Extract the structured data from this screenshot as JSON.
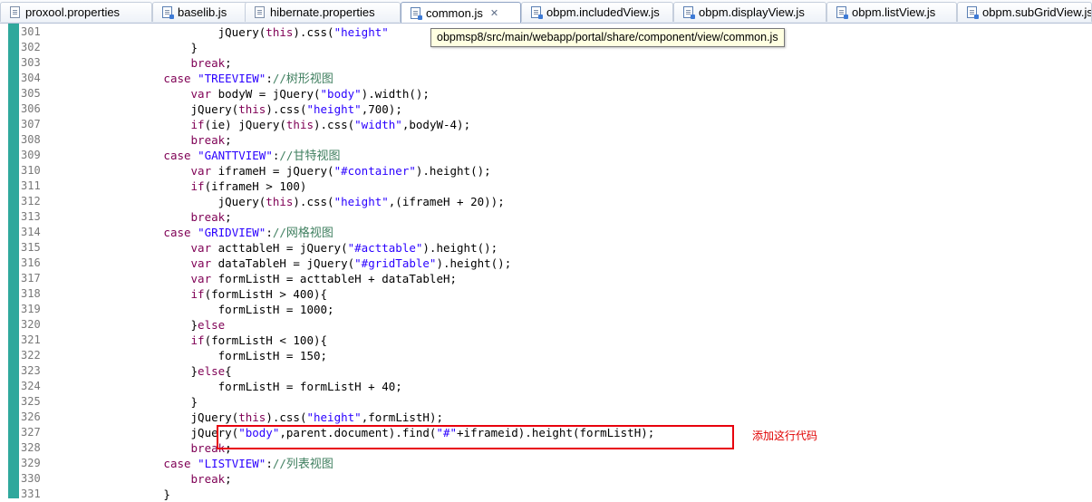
{
  "tabs": [
    {
      "label": "proxool.properties",
      "icon": "properties-file-icon",
      "active": false
    },
    {
      "label": "baselib.js",
      "icon": "js-file-icon",
      "active": false
    },
    {
      "label": "hibernate.properties",
      "icon": "properties-file-icon",
      "active": false
    },
    {
      "label": "common.js",
      "icon": "js-file-icon",
      "active": true,
      "close": "✕"
    },
    {
      "label": "obpm.includedView.js",
      "icon": "js-file-icon",
      "active": false
    },
    {
      "label": "obpm.displayView.js",
      "icon": "js-file-icon",
      "active": false
    },
    {
      "label": "obpm.listView.js",
      "icon": "js-file-icon",
      "active": false
    },
    {
      "label": "obpm.subGridView.js",
      "icon": "js-file-icon",
      "active": false
    }
  ],
  "tooltip": "obpmsp8/src/main/webapp/portal/share/component/view/common.js",
  "annotation": "添加这行代码",
  "lines": [
    {
      "n": "301",
      "segs": [
        [
          "                        jQuery(",
          ""
        ],
        [
          "this",
          "kw"
        ],
        [
          ").css(",
          ""
        ],
        [
          "\"height\"",
          "str"
        ]
      ]
    },
    {
      "n": "302",
      "segs": [
        [
          "                    }",
          ""
        ]
      ]
    },
    {
      "n": "303",
      "segs": [
        [
          "                    ",
          ""
        ],
        [
          "break",
          "kw"
        ],
        [
          ";",
          ""
        ]
      ]
    },
    {
      "n": "304",
      "segs": [
        [
          "                ",
          ""
        ],
        [
          "case",
          "kw"
        ],
        [
          " ",
          ""
        ],
        [
          "\"TREEVIEW\"",
          "str"
        ],
        [
          ":",
          ""
        ],
        [
          "//",
          "cm"
        ],
        [
          "树形视图",
          "cm-zh"
        ]
      ]
    },
    {
      "n": "305",
      "segs": [
        [
          "                    ",
          ""
        ],
        [
          "var",
          "kw"
        ],
        [
          " bodyW = jQuery(",
          ""
        ],
        [
          "\"body\"",
          "str"
        ],
        [
          ").width();",
          ""
        ]
      ]
    },
    {
      "n": "306",
      "segs": [
        [
          "                    jQuery(",
          ""
        ],
        [
          "this",
          "kw"
        ],
        [
          ").css(",
          ""
        ],
        [
          "\"height\"",
          "str"
        ],
        [
          ",700);",
          ""
        ]
      ]
    },
    {
      "n": "307",
      "segs": [
        [
          "                    ",
          ""
        ],
        [
          "if",
          "kw"
        ],
        [
          "(ie) jQuery(",
          ""
        ],
        [
          "this",
          "kw"
        ],
        [
          ").css(",
          ""
        ],
        [
          "\"width\"",
          "str"
        ],
        [
          ",bodyW-4);",
          ""
        ]
      ]
    },
    {
      "n": "308",
      "segs": [
        [
          "                    ",
          ""
        ],
        [
          "break",
          "kw"
        ],
        [
          ";",
          ""
        ]
      ]
    },
    {
      "n": "309",
      "segs": [
        [
          "                ",
          ""
        ],
        [
          "case",
          "kw"
        ],
        [
          " ",
          ""
        ],
        [
          "\"GANTTVIEW\"",
          "str"
        ],
        [
          ":",
          ""
        ],
        [
          "//",
          "cm"
        ],
        [
          "甘特视图",
          "cm-zh"
        ]
      ]
    },
    {
      "n": "310",
      "segs": [
        [
          "                    ",
          ""
        ],
        [
          "var",
          "kw"
        ],
        [
          " iframeH = jQuery(",
          ""
        ],
        [
          "\"#container\"",
          "str"
        ],
        [
          ").height();",
          ""
        ]
      ]
    },
    {
      "n": "311",
      "segs": [
        [
          "                    ",
          ""
        ],
        [
          "if",
          "kw"
        ],
        [
          "(iframeH > 100)",
          ""
        ]
      ]
    },
    {
      "n": "312",
      "segs": [
        [
          "                        jQuery(",
          ""
        ],
        [
          "this",
          "kw"
        ],
        [
          ").css(",
          ""
        ],
        [
          "\"height\"",
          "str"
        ],
        [
          ",(iframeH + 20));",
          ""
        ]
      ]
    },
    {
      "n": "313",
      "segs": [
        [
          "                    ",
          ""
        ],
        [
          "break",
          "kw"
        ],
        [
          ";",
          ""
        ]
      ]
    },
    {
      "n": "314",
      "segs": [
        [
          "                ",
          ""
        ],
        [
          "case",
          "kw"
        ],
        [
          " ",
          ""
        ],
        [
          "\"GRIDVIEW\"",
          "str"
        ],
        [
          ":",
          ""
        ],
        [
          "//",
          "cm"
        ],
        [
          "网格视图",
          "cm-zh"
        ]
      ]
    },
    {
      "n": "315",
      "segs": [
        [
          "                    ",
          ""
        ],
        [
          "var",
          "kw"
        ],
        [
          " acttableH = jQuery(",
          ""
        ],
        [
          "\"#acttable\"",
          "str"
        ],
        [
          ").height();",
          ""
        ]
      ]
    },
    {
      "n": "316",
      "segs": [
        [
          "                    ",
          ""
        ],
        [
          "var",
          "kw"
        ],
        [
          " dataTableH = jQuery(",
          ""
        ],
        [
          "\"#gridTable\"",
          "str"
        ],
        [
          ").height();",
          ""
        ]
      ]
    },
    {
      "n": "317",
      "segs": [
        [
          "                    ",
          ""
        ],
        [
          "var",
          "kw"
        ],
        [
          " formListH = acttableH + dataTableH;",
          ""
        ]
      ]
    },
    {
      "n": "318",
      "segs": [
        [
          "                    ",
          ""
        ],
        [
          "if",
          "kw"
        ],
        [
          "(formListH > 400){",
          ""
        ]
      ]
    },
    {
      "n": "319",
      "segs": [
        [
          "                        formListH = 1000;",
          ""
        ]
      ]
    },
    {
      "n": "320",
      "segs": [
        [
          "                    }",
          ""
        ],
        [
          "else",
          "kw"
        ]
      ]
    },
    {
      "n": "321",
      "segs": [
        [
          "                    ",
          ""
        ],
        [
          "if",
          "kw"
        ],
        [
          "(formListH < 100){",
          ""
        ]
      ]
    },
    {
      "n": "322",
      "segs": [
        [
          "                        formListH = 150;",
          ""
        ]
      ]
    },
    {
      "n": "323",
      "segs": [
        [
          "                    }",
          ""
        ],
        [
          "else",
          "kw"
        ],
        [
          "{",
          ""
        ]
      ]
    },
    {
      "n": "324",
      "segs": [
        [
          "                        formListH = formListH + 40;",
          ""
        ]
      ]
    },
    {
      "n": "325",
      "segs": [
        [
          "                    }",
          ""
        ]
      ]
    },
    {
      "n": "326",
      "segs": [
        [
          "                    jQuery(",
          ""
        ],
        [
          "this",
          "kw"
        ],
        [
          ").css(",
          ""
        ],
        [
          "\"height\"",
          "str"
        ],
        [
          ",formListH);",
          ""
        ]
      ]
    },
    {
      "n": "327",
      "segs": [
        [
          "                    jQuery(",
          ""
        ],
        [
          "\"body\"",
          "str"
        ],
        [
          ",parent.document).find(",
          ""
        ],
        [
          "\"#\"",
          "str"
        ],
        [
          "+iframeid).height(formListH);",
          ""
        ]
      ]
    },
    {
      "n": "328",
      "segs": [
        [
          "                    ",
          ""
        ],
        [
          "break",
          "kw"
        ],
        [
          ";",
          ""
        ]
      ]
    },
    {
      "n": "329",
      "segs": [
        [
          "                ",
          ""
        ],
        [
          "case",
          "kw"
        ],
        [
          " ",
          ""
        ],
        [
          "\"LISTVIEW\"",
          "str"
        ],
        [
          ":",
          ""
        ],
        [
          "//",
          "cm"
        ],
        [
          "列表视图",
          "cm-zh"
        ]
      ]
    },
    {
      "n": "330",
      "segs": [
        [
          "                    ",
          ""
        ],
        [
          "break",
          "kw"
        ],
        [
          ";",
          ""
        ]
      ]
    },
    {
      "n": "331",
      "segs": [
        [
          "                }",
          ""
        ]
      ]
    }
  ]
}
